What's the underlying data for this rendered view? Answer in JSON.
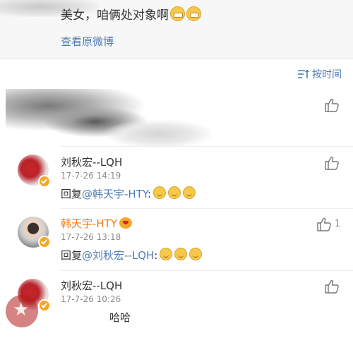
{
  "original_post": {
    "text": "美女，咱俩处对象啊",
    "emoji_names": [
      "grin-emoji",
      "grin-emoji"
    ],
    "view_original_label": "查看原微博"
  },
  "sort": {
    "label": "按时间",
    "icon": "sort-icon"
  },
  "comments": [
    {
      "name": "刘秋宏--LQH",
      "time": "17-7-26 14:19",
      "reply_prefix": "回复",
      "mention": "@韩天宇-HTY",
      "suffix": ":",
      "emoji_count": 3,
      "verified": true
    },
    {
      "name": "韩天宇-HTY",
      "time": "17-7-26 13:18",
      "reply_prefix": "回复",
      "mention": "@刘秋宏--LQH",
      "suffix": ":",
      "emoji_count": 3,
      "likes": "1",
      "vip_badge": true
    },
    {
      "name": "刘秋宏--LQH",
      "time": "17-7-26 10:26",
      "text": "哈哈",
      "verified": true
    }
  ],
  "colors": {
    "link": "#4d7cb5",
    "vip_name": "#f27a17",
    "badge": "#f5a623"
  }
}
